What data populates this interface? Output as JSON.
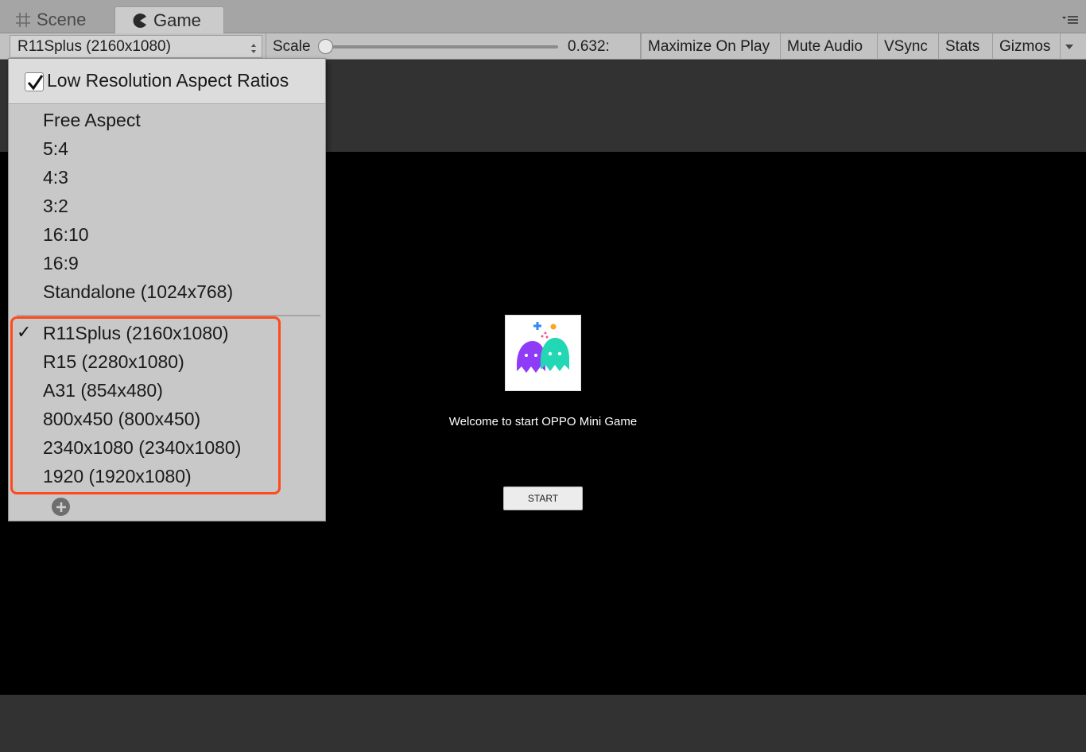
{
  "tabs": {
    "scene_label": "Scene",
    "game_label": "Game"
  },
  "toolbar": {
    "resolution_selected": "R11Splus (2160x1080)",
    "scale_label": "Scale",
    "scale_value": "0.632:",
    "maximize_on_play": "Maximize On Play",
    "mute_audio": "Mute Audio",
    "vsync": "VSync",
    "stats": "Stats",
    "gizmos": "Gizmos"
  },
  "dropdown": {
    "low_res_label": "Low Resolution Aspect Ratios",
    "low_res_checked": true,
    "builtin_items": [
      "Free Aspect",
      "5:4",
      "4:3",
      "3:2",
      "16:10",
      "16:9",
      "Standalone (1024x768)"
    ],
    "custom_items": [
      "R11Splus (2160x1080)",
      "R15 (2280x1080)",
      "A31 (854x480)",
      "800x450 (800x450)",
      "2340x1080 (2340x1080)",
      "1920 (1920x1080)"
    ],
    "selected_index": 0,
    "highlight_color": "#ff4a1c"
  },
  "game": {
    "welcome_text": "Welcome to start OPPO Mini Game",
    "start_label": "START"
  }
}
